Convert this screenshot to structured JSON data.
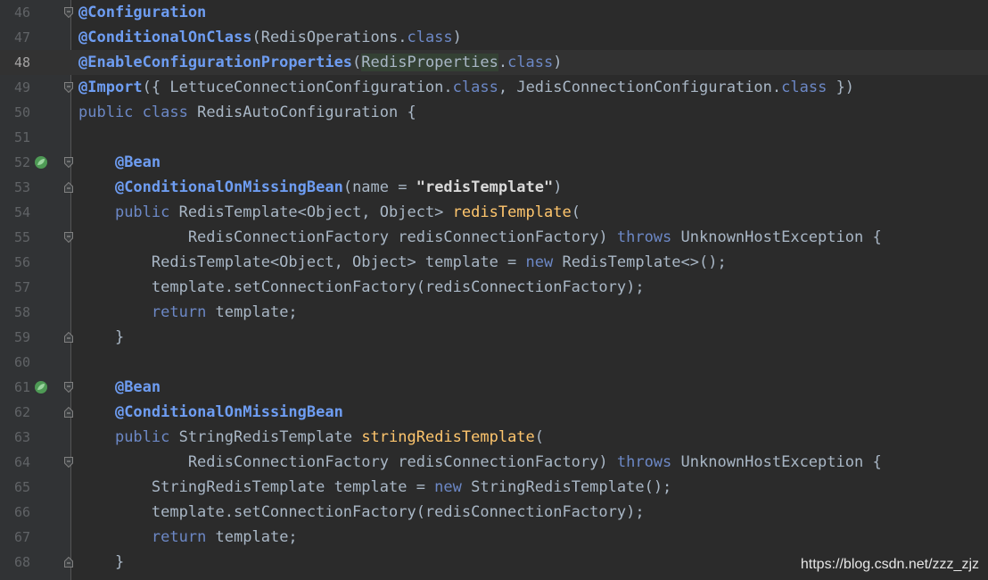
{
  "editor": {
    "watermark": "https://blog.csdn.net/zzz_zjz",
    "colors": {
      "background": "#2B2B2B",
      "gutter": "#313335",
      "annotation": "#6E9DF2",
      "keyword": "#6C88C6",
      "method": "#FFC66D",
      "plain": "#A9B7C6",
      "string": "#D9D9D9"
    },
    "lines": [
      {
        "num": "46",
        "fold": "start",
        "tokens": [
          [
            "@Configuration",
            "a"
          ]
        ]
      },
      {
        "num": "47",
        "tokens": [
          [
            "@ConditionalOnClass",
            "a"
          ],
          [
            "(RedisOperations.",
            ""
          ],
          [
            "class",
            "kb"
          ],
          [
            ")",
            ""
          ]
        ]
      },
      {
        "num": "48",
        "current": true,
        "tokens": [
          [
            "@EnableConfigurationProperties",
            "a"
          ],
          [
            "(",
            ""
          ],
          [
            "RedisProperties",
            "hl"
          ],
          [
            ".",
            ""
          ],
          [
            "class",
            "kb"
          ],
          [
            ")",
            ""
          ]
        ]
      },
      {
        "num": "49",
        "fold": "start",
        "tokens": [
          [
            "@Import",
            "a"
          ],
          [
            "({ LettuceConnectionConfiguration.",
            ""
          ],
          [
            "class",
            "kb"
          ],
          [
            ", ",
            ""
          ],
          [
            "JedisConnectionConfiguration.",
            ""
          ],
          [
            "class",
            "kb"
          ],
          [
            " })",
            ""
          ]
        ]
      },
      {
        "num": "50",
        "tokens": [
          [
            "public ",
            "kb"
          ],
          [
            "class ",
            "kb"
          ],
          [
            "RedisAutoConfiguration {",
            ""
          ]
        ]
      },
      {
        "num": "51",
        "tokens": []
      },
      {
        "num": "52",
        "run": true,
        "fold": "start",
        "tokens": [
          [
            "    ",
            ""
          ],
          [
            "@Bean",
            "a"
          ]
        ]
      },
      {
        "num": "53",
        "fold": "end",
        "tokens": [
          [
            "    ",
            ""
          ],
          [
            "@ConditionalOnMissingBean",
            "a"
          ],
          [
            "(name = ",
            ""
          ],
          [
            "\"redisTemplate\"",
            "s"
          ],
          [
            ")",
            ""
          ]
        ]
      },
      {
        "num": "54",
        "tokens": [
          [
            "    ",
            ""
          ],
          [
            "public ",
            "kb"
          ],
          [
            "RedisTemplate<Object, Object> ",
            ""
          ],
          [
            "redisTemplate",
            "m"
          ],
          [
            "(",
            ""
          ]
        ]
      },
      {
        "num": "55",
        "fold": "start",
        "tokens": [
          [
            "            RedisConnectionFactory redisConnectionFactory) ",
            ""
          ],
          [
            "throws ",
            "kb"
          ],
          [
            "UnknownHostException {",
            ""
          ]
        ]
      },
      {
        "num": "56",
        "tokens": [
          [
            "        RedisTemplate<Object, Object> template = ",
            ""
          ],
          [
            "new ",
            "kb"
          ],
          [
            "RedisTemplate<>();",
            ""
          ]
        ]
      },
      {
        "num": "57",
        "tokens": [
          [
            "        template.setConnectionFactory(redisConnectionFactory);",
            ""
          ]
        ]
      },
      {
        "num": "58",
        "tokens": [
          [
            "        ",
            ""
          ],
          [
            "return ",
            "kb"
          ],
          [
            "template;",
            ""
          ]
        ]
      },
      {
        "num": "59",
        "fold": "end",
        "tokens": [
          [
            "    }",
            ""
          ]
        ]
      },
      {
        "num": "60",
        "tokens": []
      },
      {
        "num": "61",
        "run": true,
        "fold": "start",
        "tokens": [
          [
            "    ",
            ""
          ],
          [
            "@Bean",
            "a"
          ]
        ]
      },
      {
        "num": "62",
        "fold": "end",
        "tokens": [
          [
            "    ",
            ""
          ],
          [
            "@ConditionalOnMissingBean",
            "a"
          ]
        ]
      },
      {
        "num": "63",
        "tokens": [
          [
            "    ",
            ""
          ],
          [
            "public ",
            "kb"
          ],
          [
            "StringRedisTemplate ",
            ""
          ],
          [
            "stringRedisTemplate",
            "m"
          ],
          [
            "(",
            ""
          ]
        ]
      },
      {
        "num": "64",
        "fold": "start",
        "tokens": [
          [
            "            RedisConnectionFactory redisConnectionFactory) ",
            ""
          ],
          [
            "throws ",
            "kb"
          ],
          [
            "UnknownHostException {",
            ""
          ]
        ]
      },
      {
        "num": "65",
        "tokens": [
          [
            "        StringRedisTemplate template = ",
            ""
          ],
          [
            "new ",
            "kb"
          ],
          [
            "StringRedisTemplate();",
            ""
          ]
        ]
      },
      {
        "num": "66",
        "tokens": [
          [
            "        template.setConnectionFactory(redisConnectionFactory);",
            ""
          ]
        ]
      },
      {
        "num": "67",
        "tokens": [
          [
            "        ",
            ""
          ],
          [
            "return ",
            "kb"
          ],
          [
            "template;",
            ""
          ]
        ]
      },
      {
        "num": "68",
        "fold": "end",
        "tokens": [
          [
            "    }",
            ""
          ]
        ]
      }
    ]
  }
}
